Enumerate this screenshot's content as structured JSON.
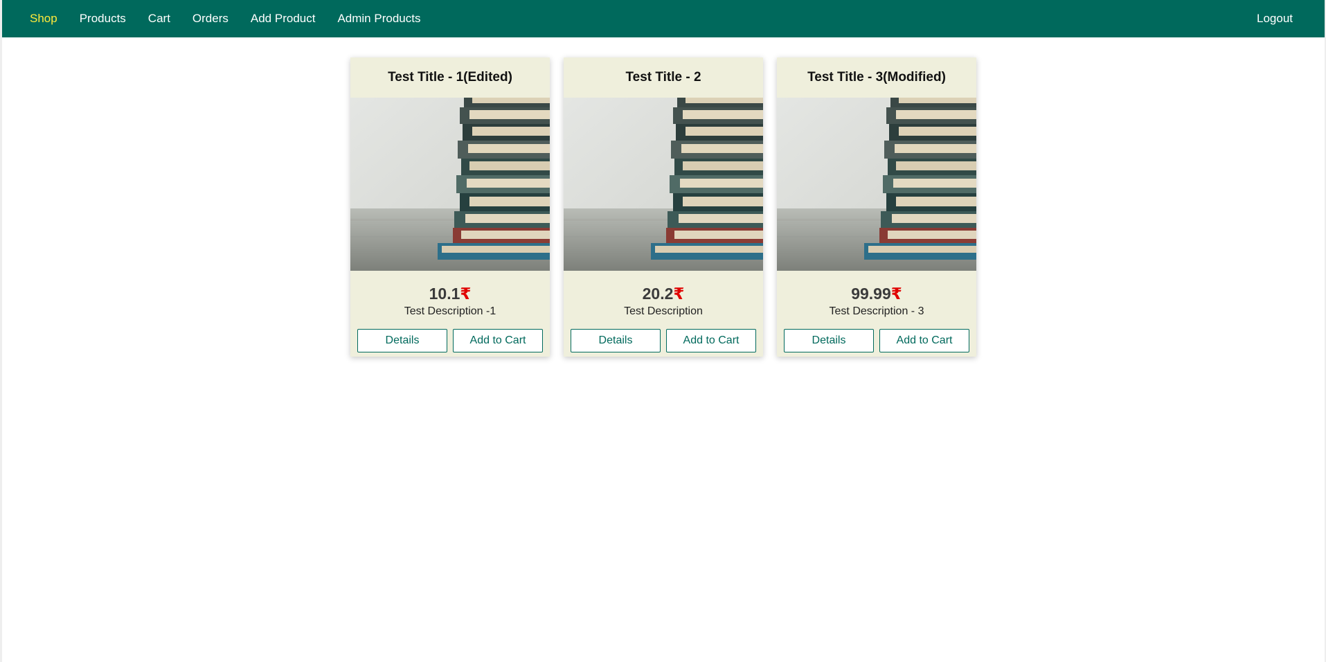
{
  "nav": {
    "items": [
      {
        "label": "Shop",
        "active": true
      },
      {
        "label": "Products",
        "active": false
      },
      {
        "label": "Cart",
        "active": false
      },
      {
        "label": "Orders",
        "active": false
      },
      {
        "label": "Add Product",
        "active": false
      },
      {
        "label": "Admin Products",
        "active": false
      }
    ],
    "logout_label": "Logout"
  },
  "products": [
    {
      "title": "Test Title - 1(Edited)",
      "price": "10.1",
      "currency": "₹",
      "description": "Test Description -1",
      "details_label": "Details",
      "add_to_cart_label": "Add to Cart"
    },
    {
      "title": "Test Title - 2",
      "price": "20.2",
      "currency": "₹",
      "description": "Test Description",
      "details_label": "Details",
      "add_to_cart_label": "Add to Cart"
    },
    {
      "title": "Test Title - 3(Modified)",
      "price": "99.99",
      "currency": "₹",
      "description": "Test Description - 3",
      "details_label": "Details",
      "add_to_cart_label": "Add to Cart"
    }
  ],
  "colors": {
    "navbar": "#00695c",
    "active_link": "#ffeb3b",
    "card_bg": "#efefdc",
    "currency": "#e00000"
  }
}
